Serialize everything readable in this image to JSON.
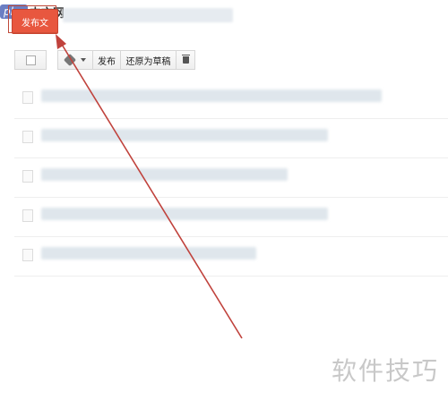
{
  "watermark_logo": {
    "php": "php",
    "cn": "中文网"
  },
  "new_post_button": {
    "label": "发布文"
  },
  "toolbar": {
    "publish": "发布",
    "revert_to_draft": "还原为草稿",
    "delete_icon": "trash-icon",
    "label_icon": "tag-icon"
  },
  "posts": [
    {
      "checked": false
    },
    {
      "checked": false
    },
    {
      "checked": false
    },
    {
      "checked": false
    },
    {
      "checked": false
    }
  ],
  "watermark_text": "软件技巧",
  "colors": {
    "button": "#e8573f",
    "arrow": "#c0423c"
  }
}
